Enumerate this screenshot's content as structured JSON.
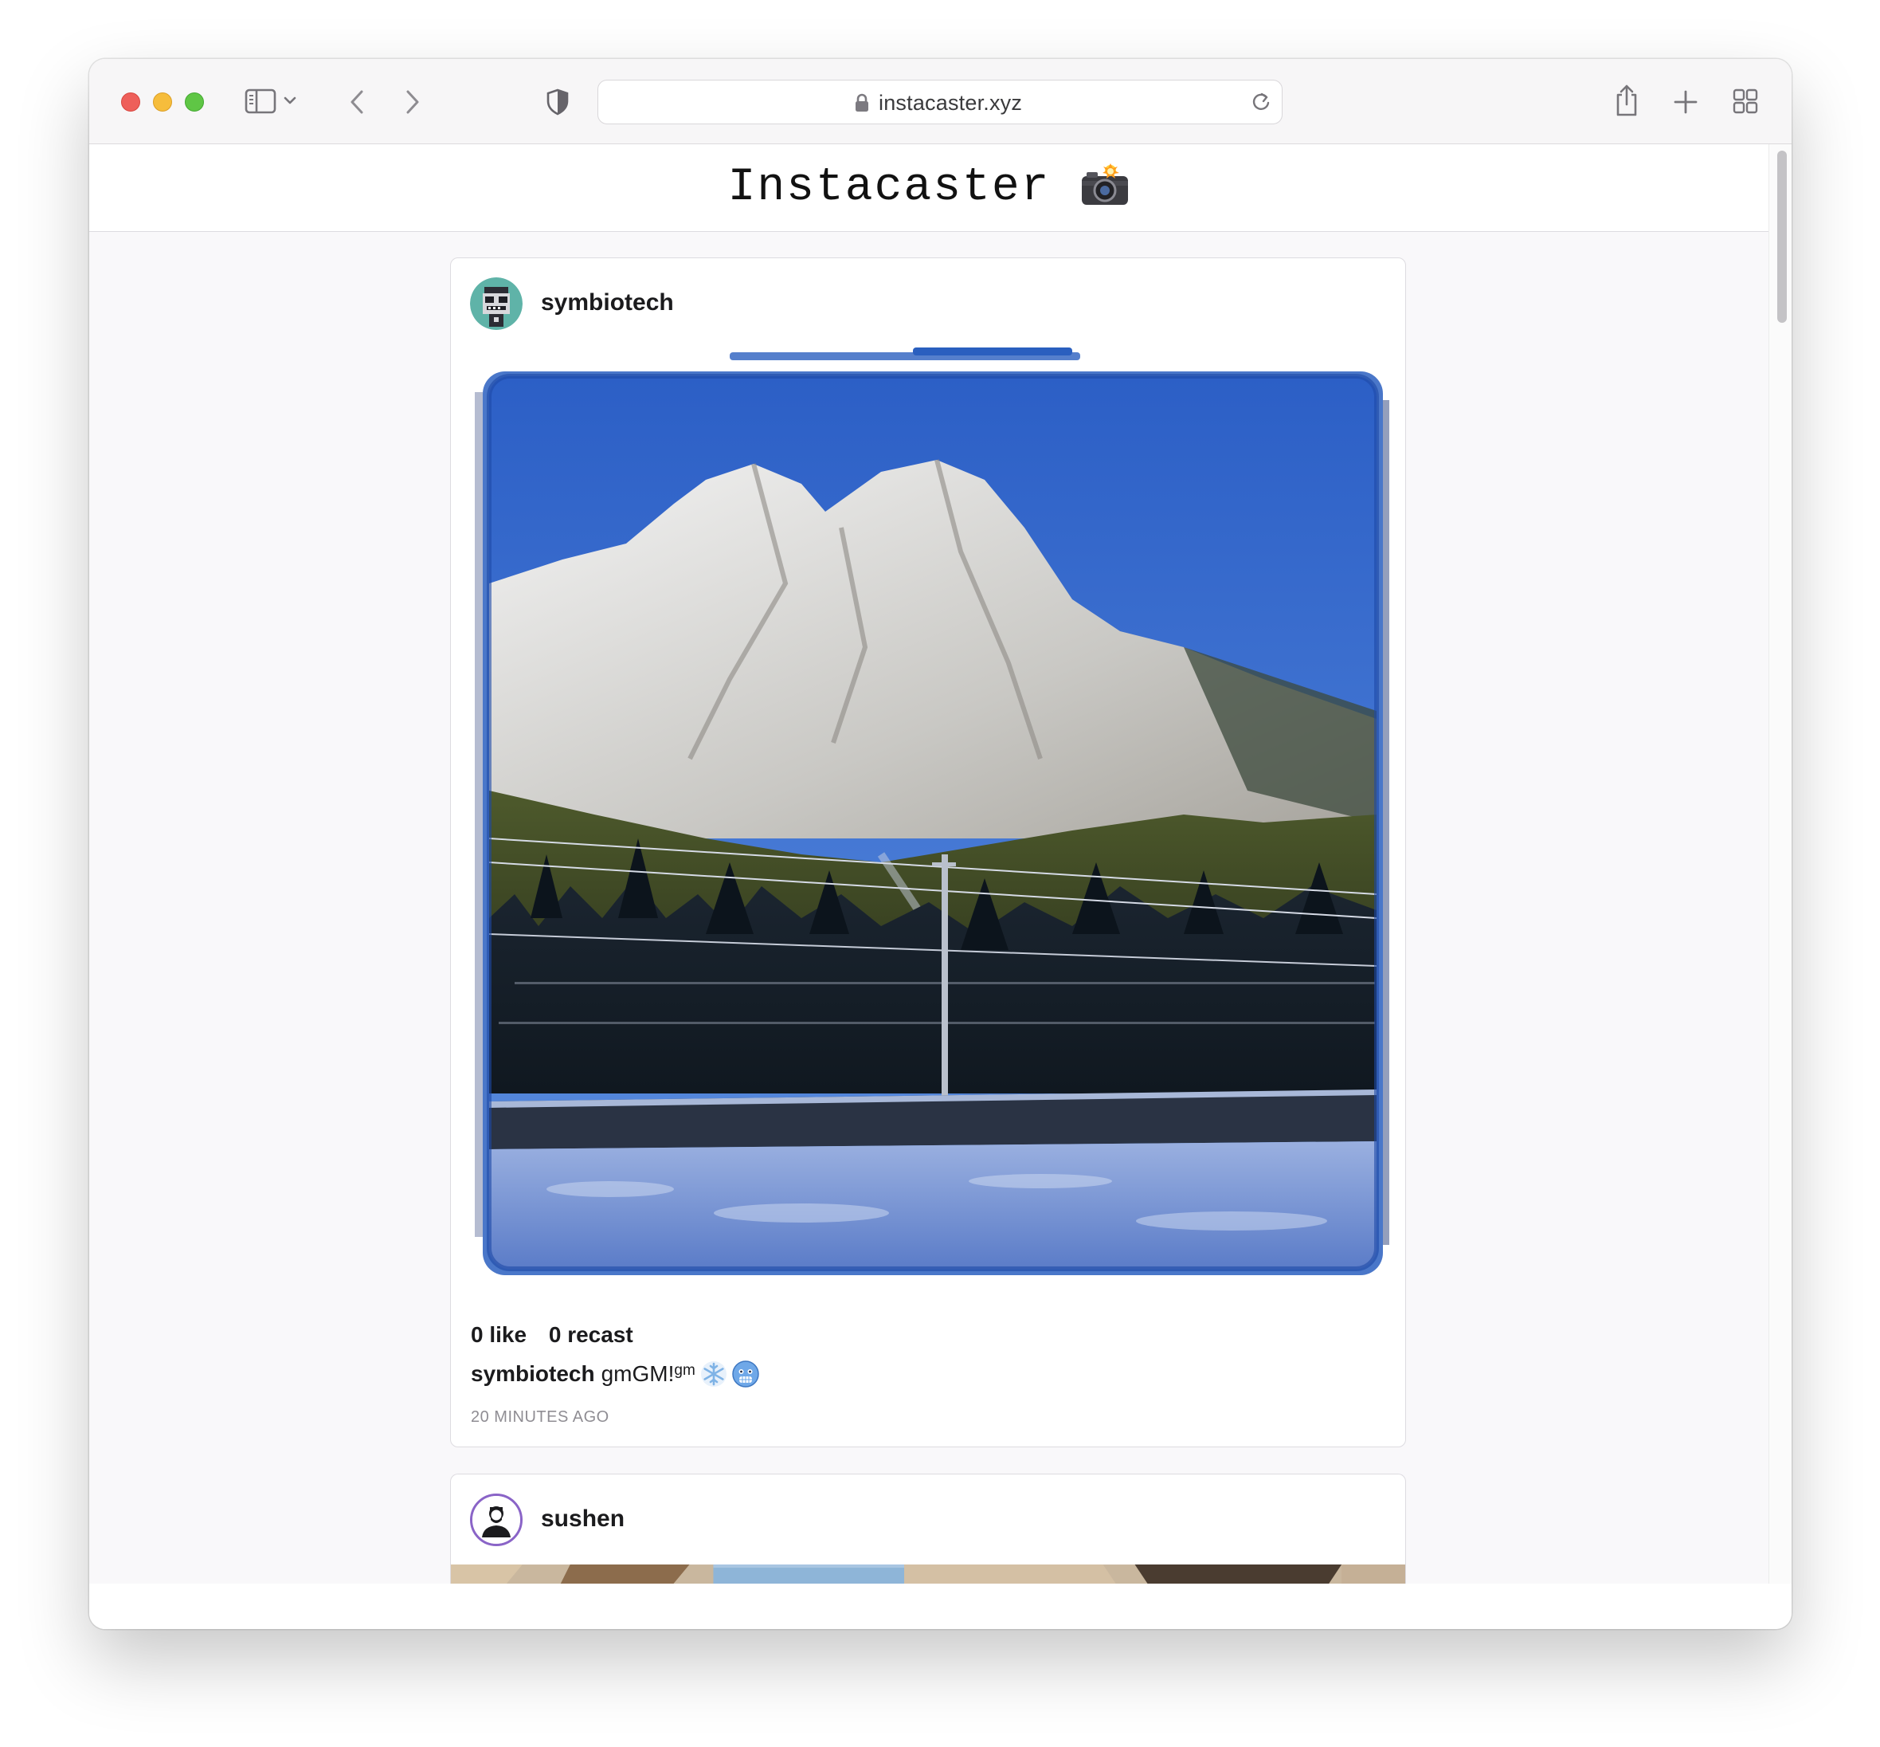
{
  "browser": {
    "url": "instacaster.xyz"
  },
  "site": {
    "title": "Instacaster"
  },
  "posts": [
    {
      "username": "symbiotech",
      "likes": "0 like",
      "recasts": "0 recast",
      "caption_user": "symbiotech",
      "caption_text": "gmGM!",
      "caption_sup": "gm",
      "timestamp": "20 MINUTES AGO",
      "caption_emojis": [
        "snowflake-icon",
        "cold-face-icon"
      ]
    },
    {
      "username": "sushen"
    }
  ],
  "colors": {
    "sky": "#3f6fcf",
    "frame_blue": "#2a5fbf",
    "avatar_ring": "#8a64c7"
  }
}
